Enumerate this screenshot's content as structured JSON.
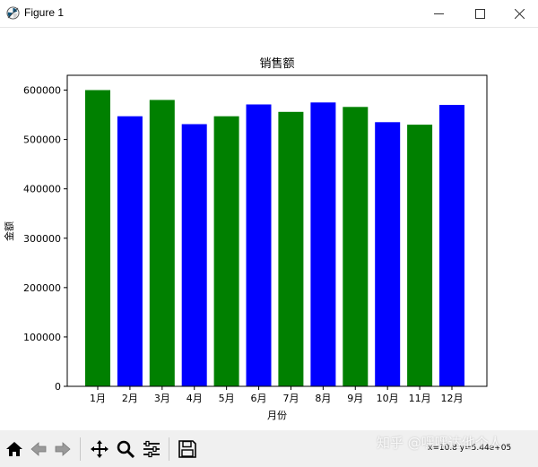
{
  "window": {
    "title": "Figure 1"
  },
  "toolbar": {
    "buttons": [
      {
        "name": "home-button",
        "icon": "home-icon"
      },
      {
        "name": "back-button",
        "icon": "arrow-left-icon"
      },
      {
        "name": "forward-button",
        "icon": "arrow-right-icon"
      },
      {
        "name": "pan-button",
        "icon": "move-icon"
      },
      {
        "name": "zoom-button",
        "icon": "magnifier-icon"
      },
      {
        "name": "configure-subplots-button",
        "icon": "sliders-icon"
      },
      {
        "name": "save-button",
        "icon": "floppy-disk-icon"
      }
    ],
    "coords": "x=10.8  y=5.44e+05"
  },
  "watermark": "知乎 @嘿嘿达他个人",
  "chart_data": {
    "type": "bar",
    "title": "销售额",
    "xlabel": "月份",
    "ylabel": "金额",
    "categories": [
      "1月",
      "2月",
      "3月",
      "4月",
      "5月",
      "6月",
      "7月",
      "8月",
      "9月",
      "10月",
      "11月",
      "12月"
    ],
    "values": [
      600000,
      547000,
      580000,
      531000,
      547000,
      571000,
      556000,
      575000,
      566000,
      535000,
      530000,
      570000
    ],
    "colors": [
      "#008000",
      "#0000ff",
      "#008000",
      "#0000ff",
      "#008000",
      "#0000ff",
      "#008000",
      "#0000ff",
      "#008000",
      "#0000ff",
      "#008000",
      "#0000ff"
    ],
    "ylim": [
      0,
      630000
    ],
    "yticks": [
      0,
      100000,
      200000,
      300000,
      400000,
      500000,
      600000
    ],
    "ytick_labels": [
      "0",
      "100000",
      "200000",
      "300000",
      "400000",
      "500000",
      "600000"
    ],
    "grid": false,
    "legend": "none"
  }
}
